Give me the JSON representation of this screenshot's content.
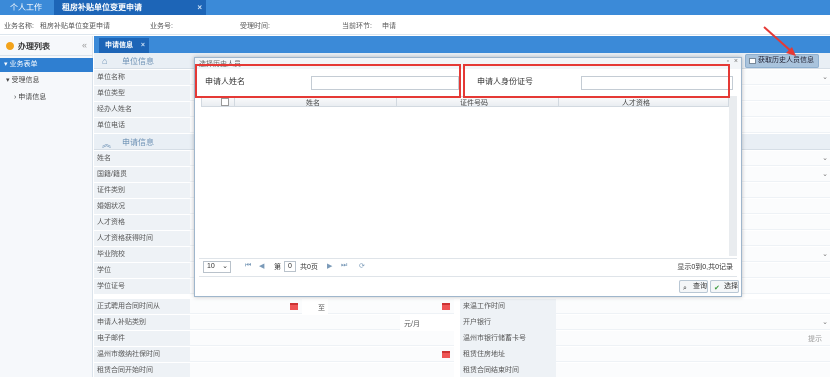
{
  "top_tabs": {
    "home": "个人工作台",
    "active": "租房补贴单位变更申请"
  },
  "info": {
    "business_name_label": "业务名称:",
    "business_name": "租房补贴单位变更申请",
    "business_no_label": "业务号:",
    "accept_time_label": "受理时间:",
    "current_step_label": "当前环节:",
    "current_step": "申请"
  },
  "sidebar": {
    "title": "办理列表",
    "items": [
      {
        "label": "▾ 业务表单"
      },
      {
        "label": "▾ 受理信息"
      },
      {
        "label": "› 申请信息"
      }
    ]
  },
  "content_tab": "申请信息",
  "fetch_button": "获取历史人员信息",
  "sections": {
    "unit_info": "单位信息",
    "apply_info": "申请信息"
  },
  "unit_fields": [
    "单位名称",
    "单位类型",
    "经办人姓名",
    "单位电话"
  ],
  "apply_fields": [
    "姓名",
    "国籍/籍贯",
    "证件类别",
    "婚姻状况",
    "人才资格",
    "人才资格获得时间",
    "毕业院校",
    "学位",
    "学位证号",
    "正式聘用合同时间从",
    "申请人补贴类别",
    "电子邮件",
    "温州市缴纳社保时间",
    "租赁合同开始时间"
  ],
  "right_fields": [
    "来温工作时间",
    "开户银行",
    "温州市银行储蓄卡号",
    "租赁住房地址",
    "租赁合同结束时间"
  ],
  "form_misc": {
    "to": "至",
    "unit": "元/月",
    "hint": "提示"
  },
  "modal": {
    "title": "选择历史人员",
    "name_label": "申请人姓名",
    "name_value": "",
    "id_label": "申请人身份证号",
    "id_value": "",
    "columns": [
      "姓名",
      "证件号码",
      "人才资格"
    ],
    "page_size": "10",
    "page_prefix": "第",
    "page_no": "0",
    "page_total": "共0页",
    "summary": "显示0到0,共0记录",
    "query_button": "查询",
    "select_button": "选择"
  }
}
